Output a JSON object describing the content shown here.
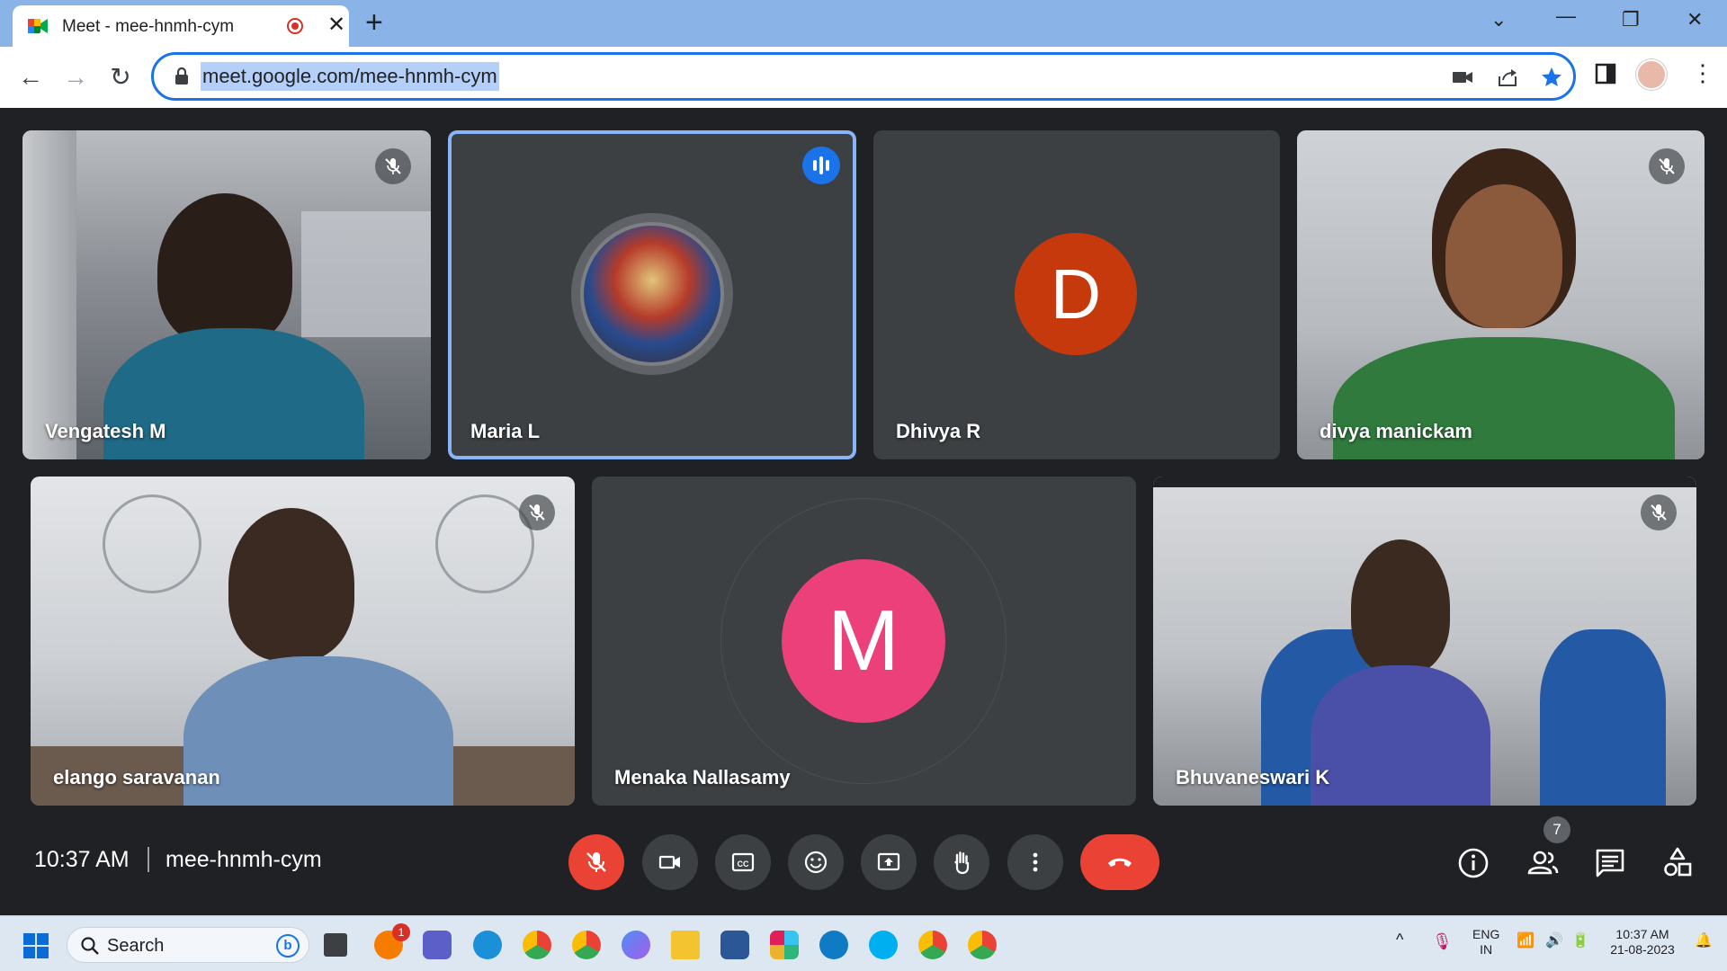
{
  "browser": {
    "tab_title": "Meet - mee-hnmh-cym",
    "url": "meet.google.com/mee-hnmh-cym"
  },
  "meeting": {
    "time": "10:37 AM",
    "code": "mee-hnmh-cym",
    "participant_count": "7"
  },
  "participants": [
    {
      "name": "Vengatesh M",
      "muted": true,
      "video": true
    },
    {
      "name": "Maria L",
      "muted": false,
      "video": false,
      "speaking": true
    },
    {
      "name": "Dhivya R",
      "muted": false,
      "video": false,
      "avatar_letter": "D",
      "avatar_color": "#c5390d"
    },
    {
      "name": "divya manickam",
      "muted": true,
      "video": true
    },
    {
      "name": "elango saravanan",
      "muted": true,
      "video": true
    },
    {
      "name": "Menaka Nallasamy",
      "muted": false,
      "video": false,
      "avatar_letter": "M",
      "avatar_color": "#ec407a"
    },
    {
      "name": "Bhuvaneswari K",
      "muted": true,
      "video": true
    }
  ],
  "controls": [
    "microphone-off",
    "camera",
    "captions",
    "reactions",
    "present-screen",
    "raise-hand",
    "more-options",
    "leave-call"
  ],
  "side_controls": [
    "meeting-details",
    "people",
    "chat",
    "activities"
  ],
  "taskbar": {
    "search_label": "Search",
    "notification_badge": "1",
    "language_top": "ENG",
    "language_bottom": "IN",
    "clock_time": "10:37 AM",
    "clock_date": "21-08-2023"
  },
  "colors": {
    "accent_blue": "#1a73e8",
    "leave_red": "#ea4335",
    "tile_bg": "#3c4043",
    "stage_bg": "#202124"
  }
}
